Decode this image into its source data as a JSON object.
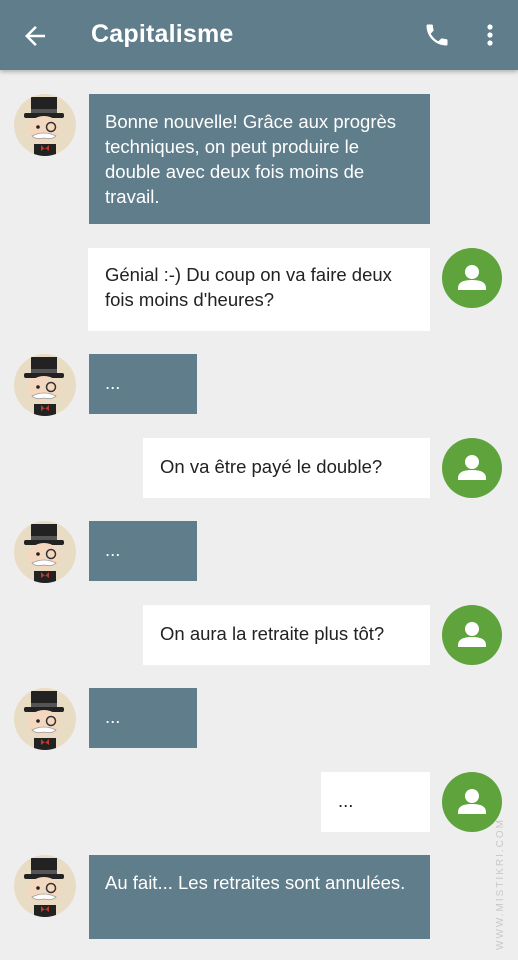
{
  "header": {
    "title": "Capitalisme",
    "back_icon": "arrow-back-icon",
    "call_icon": "phone-icon",
    "menu_icon": "more-vert-icon",
    "bar_color": "#607d8b"
  },
  "messages": [
    {
      "from": "capitalisme",
      "text": "Bonne nouvelle! Grâce aux progrès techniques, on peut produire le double avec deux fois moins de travail."
    },
    {
      "from": "user",
      "text": "Génial :-) Du coup on va faire deux fois moins d'heures?"
    },
    {
      "from": "capitalisme",
      "text": "..."
    },
    {
      "from": "user",
      "text": "On va être payé le double?"
    },
    {
      "from": "capitalisme",
      "text": "..."
    },
    {
      "from": "user",
      "text": "On aura la retraite plus tôt?"
    },
    {
      "from": "capitalisme",
      "text": "..."
    },
    {
      "from": "user",
      "text": "..."
    },
    {
      "from": "capitalisme",
      "text": "Au fait... Les retraites sont annulées."
    }
  ],
  "colors": {
    "incoming_bubble": "#607d8b",
    "outgoing_bubble": "#ffffff",
    "user_avatar": "#5fa33d",
    "background": "#eeeeee"
  },
  "watermark": "WWW.MISTIKRI.COM"
}
